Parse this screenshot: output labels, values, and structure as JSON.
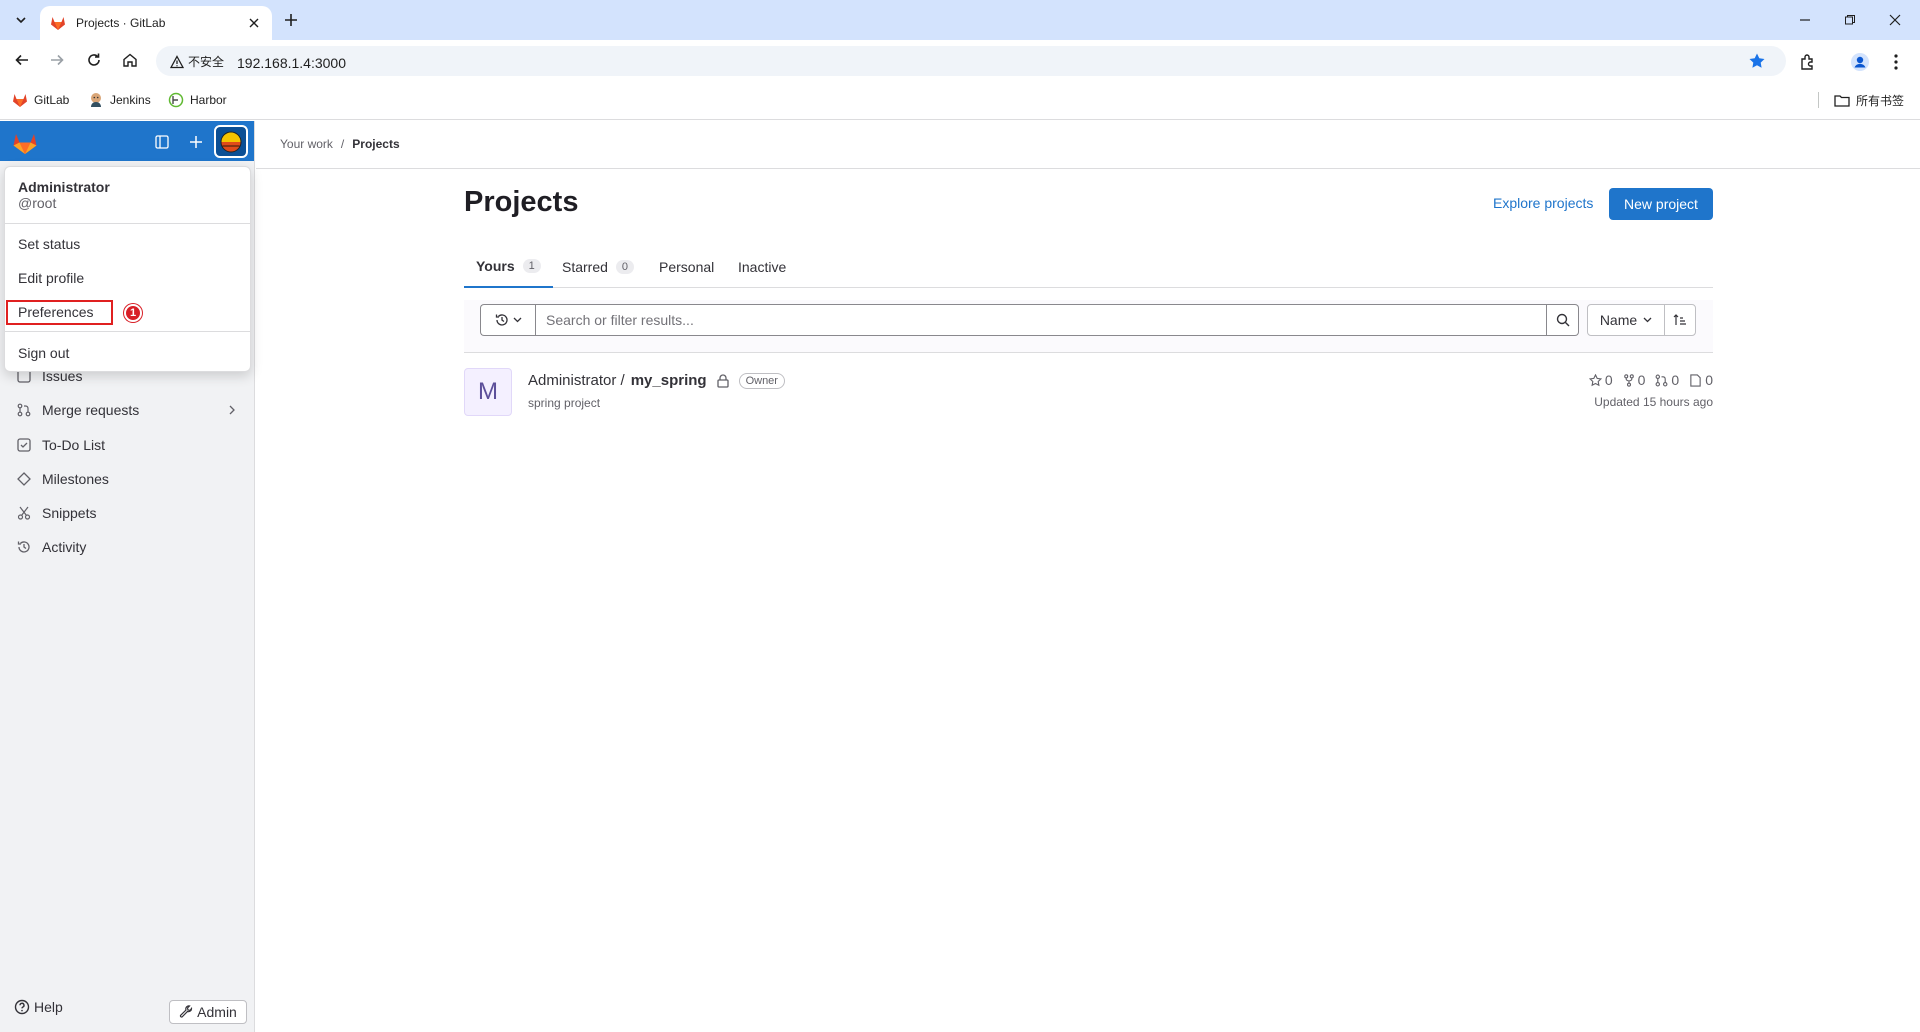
{
  "browser": {
    "tab_title": "Projects · GitLab",
    "security_label": "不安全",
    "url": "192.168.1.4:3000",
    "bookmarks": [
      {
        "label": "GitLab",
        "icon": "gitlab-icon"
      },
      {
        "label": "Jenkins",
        "icon": "jenkins-icon"
      },
      {
        "label": "Harbor",
        "icon": "harbor-icon"
      }
    ],
    "all_bookmarks_label": "所有书签"
  },
  "sidebar": {
    "items": [
      {
        "label": "Issues",
        "icon": "issues-icon"
      },
      {
        "label": "Merge requests",
        "icon": "merge-request-icon"
      },
      {
        "label": "To-Do List",
        "icon": "todo-icon"
      },
      {
        "label": "Milestones",
        "icon": "milestone-icon"
      },
      {
        "label": "Snippets",
        "icon": "snippet-icon"
      },
      {
        "label": "Activity",
        "icon": "history-icon"
      }
    ],
    "help_label": "Help",
    "admin_label": "Admin",
    "brand_color": "#1f75cb"
  },
  "user_menu": {
    "name": "Administrator",
    "handle": "@root",
    "items": [
      "Set status",
      "Edit profile",
      "Preferences",
      "Sign out"
    ],
    "annotation_number": "1"
  },
  "breadcrumb": {
    "parent": "Your work",
    "separator": "/",
    "current": "Projects"
  },
  "main": {
    "title": "Projects",
    "explore_label": "Explore projects",
    "new_project_label": "New project",
    "tabs": [
      {
        "label": "Yours",
        "count": "1"
      },
      {
        "label": "Starred",
        "count": "0"
      },
      {
        "label": "Personal",
        "count": ""
      },
      {
        "label": "Inactive",
        "count": ""
      }
    ],
    "search_placeholder": "Search or filter results...",
    "sort_label": "Name"
  },
  "project": {
    "avatar_letter": "M",
    "namespace": "Administrator /",
    "name": "my_spring",
    "role": "Owner",
    "description": "spring project",
    "stars": "0",
    "forks": "0",
    "merge_requests": "0",
    "issues": "0",
    "updated": "Updated 15 hours ago"
  }
}
